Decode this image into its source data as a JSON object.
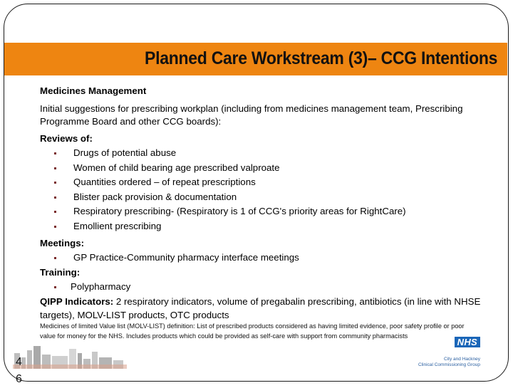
{
  "slide": {
    "title": "Planned Care Workstream (3)– CCG Intentions",
    "page_number_line1": "4",
    "page_number_line2": "6",
    "accent_color": "#EE8511"
  },
  "content": {
    "section_heading": "Medicines Management",
    "intro": "Initial suggestions for prescribing workplan (including from medicines management team, Prescribing Programme Board and other CCG boards):",
    "reviews": {
      "heading": "Reviews of:",
      "items": [
        "Drugs of potential abuse",
        "Women of child bearing age prescribed valproate",
        "Quantities ordered – of repeat prescriptions",
        "Blister pack provision & documentation",
        "Respiratory prescribing- (Respiratory is 1 of CCG's priority areas for RightCare)",
        "Emollient prescribing"
      ]
    },
    "meetings": {
      "heading": "Meetings:",
      "items": [
        "GP Practice-Community pharmacy interface meetings"
      ]
    },
    "training": {
      "heading": "Training:",
      "items": [
        "Polypharmacy"
      ]
    },
    "qipp": {
      "label": "QIPP Indicators:",
      "text": " 2 respiratory indicators, volume of pregabalin prescribing, antibiotics (in line with NHSE targets), MOLV-LIST products, OTC products"
    },
    "footnote": "Medicines of limited Value list (MOLV-LIST) definition: List of prescribed products considered as having limited evidence, poor safety profile or poor value for money for the NHS. Includes products which could be provided as self-care with support from community pharmacists"
  },
  "logo": {
    "badge": "NHS",
    "line1": "City and Hackney",
    "line2": "Clinical Commissioning Group",
    "badge_color": "#1a66b8"
  },
  "decor": {
    "skyline_icon": "city-skyline-image"
  }
}
